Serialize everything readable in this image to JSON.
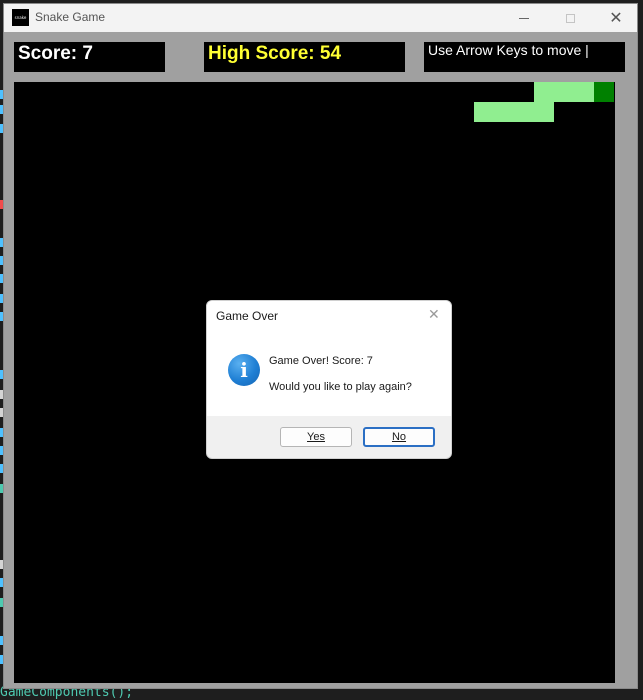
{
  "window": {
    "title": "Snake Game",
    "icon_label": "snake"
  },
  "hud": {
    "score_text": "Score: 7",
    "high_score_text": "High Score: 54",
    "hint_text": "Use Arrow Keys to move |"
  },
  "board": {
    "background": "#000000",
    "snake": {
      "head_color": "#008000",
      "body_color": "#90ee90",
      "cells": [
        {
          "col": 29,
          "row": 0,
          "part": "head"
        },
        {
          "col": 28,
          "row": 0,
          "part": "body"
        },
        {
          "col": 27,
          "row": 0,
          "part": "body"
        },
        {
          "col": 26,
          "row": 0,
          "part": "body"
        },
        {
          "col": 26,
          "row": 1,
          "part": "body"
        },
        {
          "col": 25,
          "row": 1,
          "part": "body"
        },
        {
          "col": 24,
          "row": 1,
          "part": "body"
        },
        {
          "col": 23,
          "row": 1,
          "part": "body"
        }
      ]
    }
  },
  "dialog": {
    "title": "Game Over",
    "message_line1": "Game Over! Score: 7",
    "message_line2": "Would you like to play again?",
    "yes_label": "Yes",
    "no_label": "No",
    "icon": "info-icon"
  },
  "background_code": {
    "bottom_line": "GameComponents();"
  },
  "colors": {
    "window_frame": "#a0a0a0",
    "score_text": "#ffffff",
    "high_score_text": "#ffff33",
    "default_button_border": "#2b6fc4"
  }
}
